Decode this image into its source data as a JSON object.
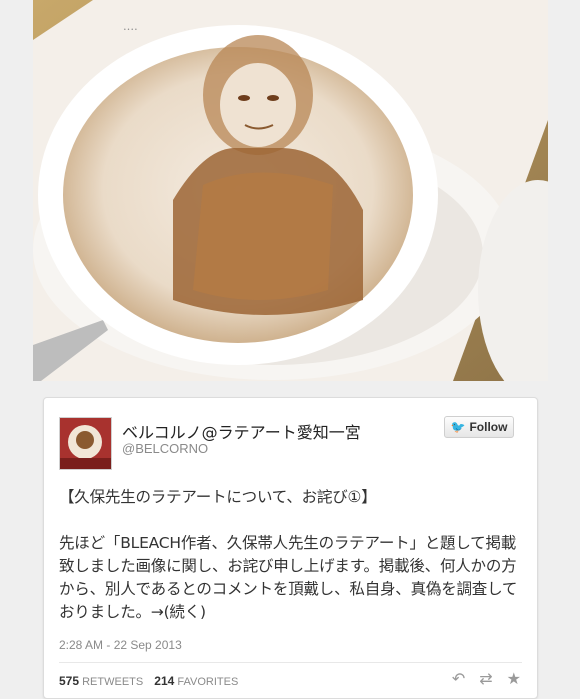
{
  "tweet": {
    "display_name": "ベルコルノ@ラテアート愛知一宮",
    "handle": "@BELCORNO",
    "follow_label": "Follow",
    "text_line1": "【久保先生のラテアートについて、お詫び①】",
    "text_body": "先ほど「BLEACH作者、久保帯人先生のラテアート」と題して掲載致しました画像に関し、お詫び申し上げます。掲載後、何人かの方から、別人であるとのコメントを頂戴し、私自身、真偽を調査しておりました。→(続く)",
    "timestamp": "2:28 AM - 22 Sep 2013",
    "retweets_count": "575",
    "retweets_label": "RETWEETS",
    "favorites_count": "214",
    "favorites_label": "FAVORITES"
  },
  "icons": {
    "follow": "twitter-bird-icon",
    "reply": "reply-icon",
    "retweet": "retweet-icon",
    "favorite": "star-icon"
  },
  "colors": {
    "twitter_blue": "#2fa9e1",
    "background": "#efefef"
  }
}
